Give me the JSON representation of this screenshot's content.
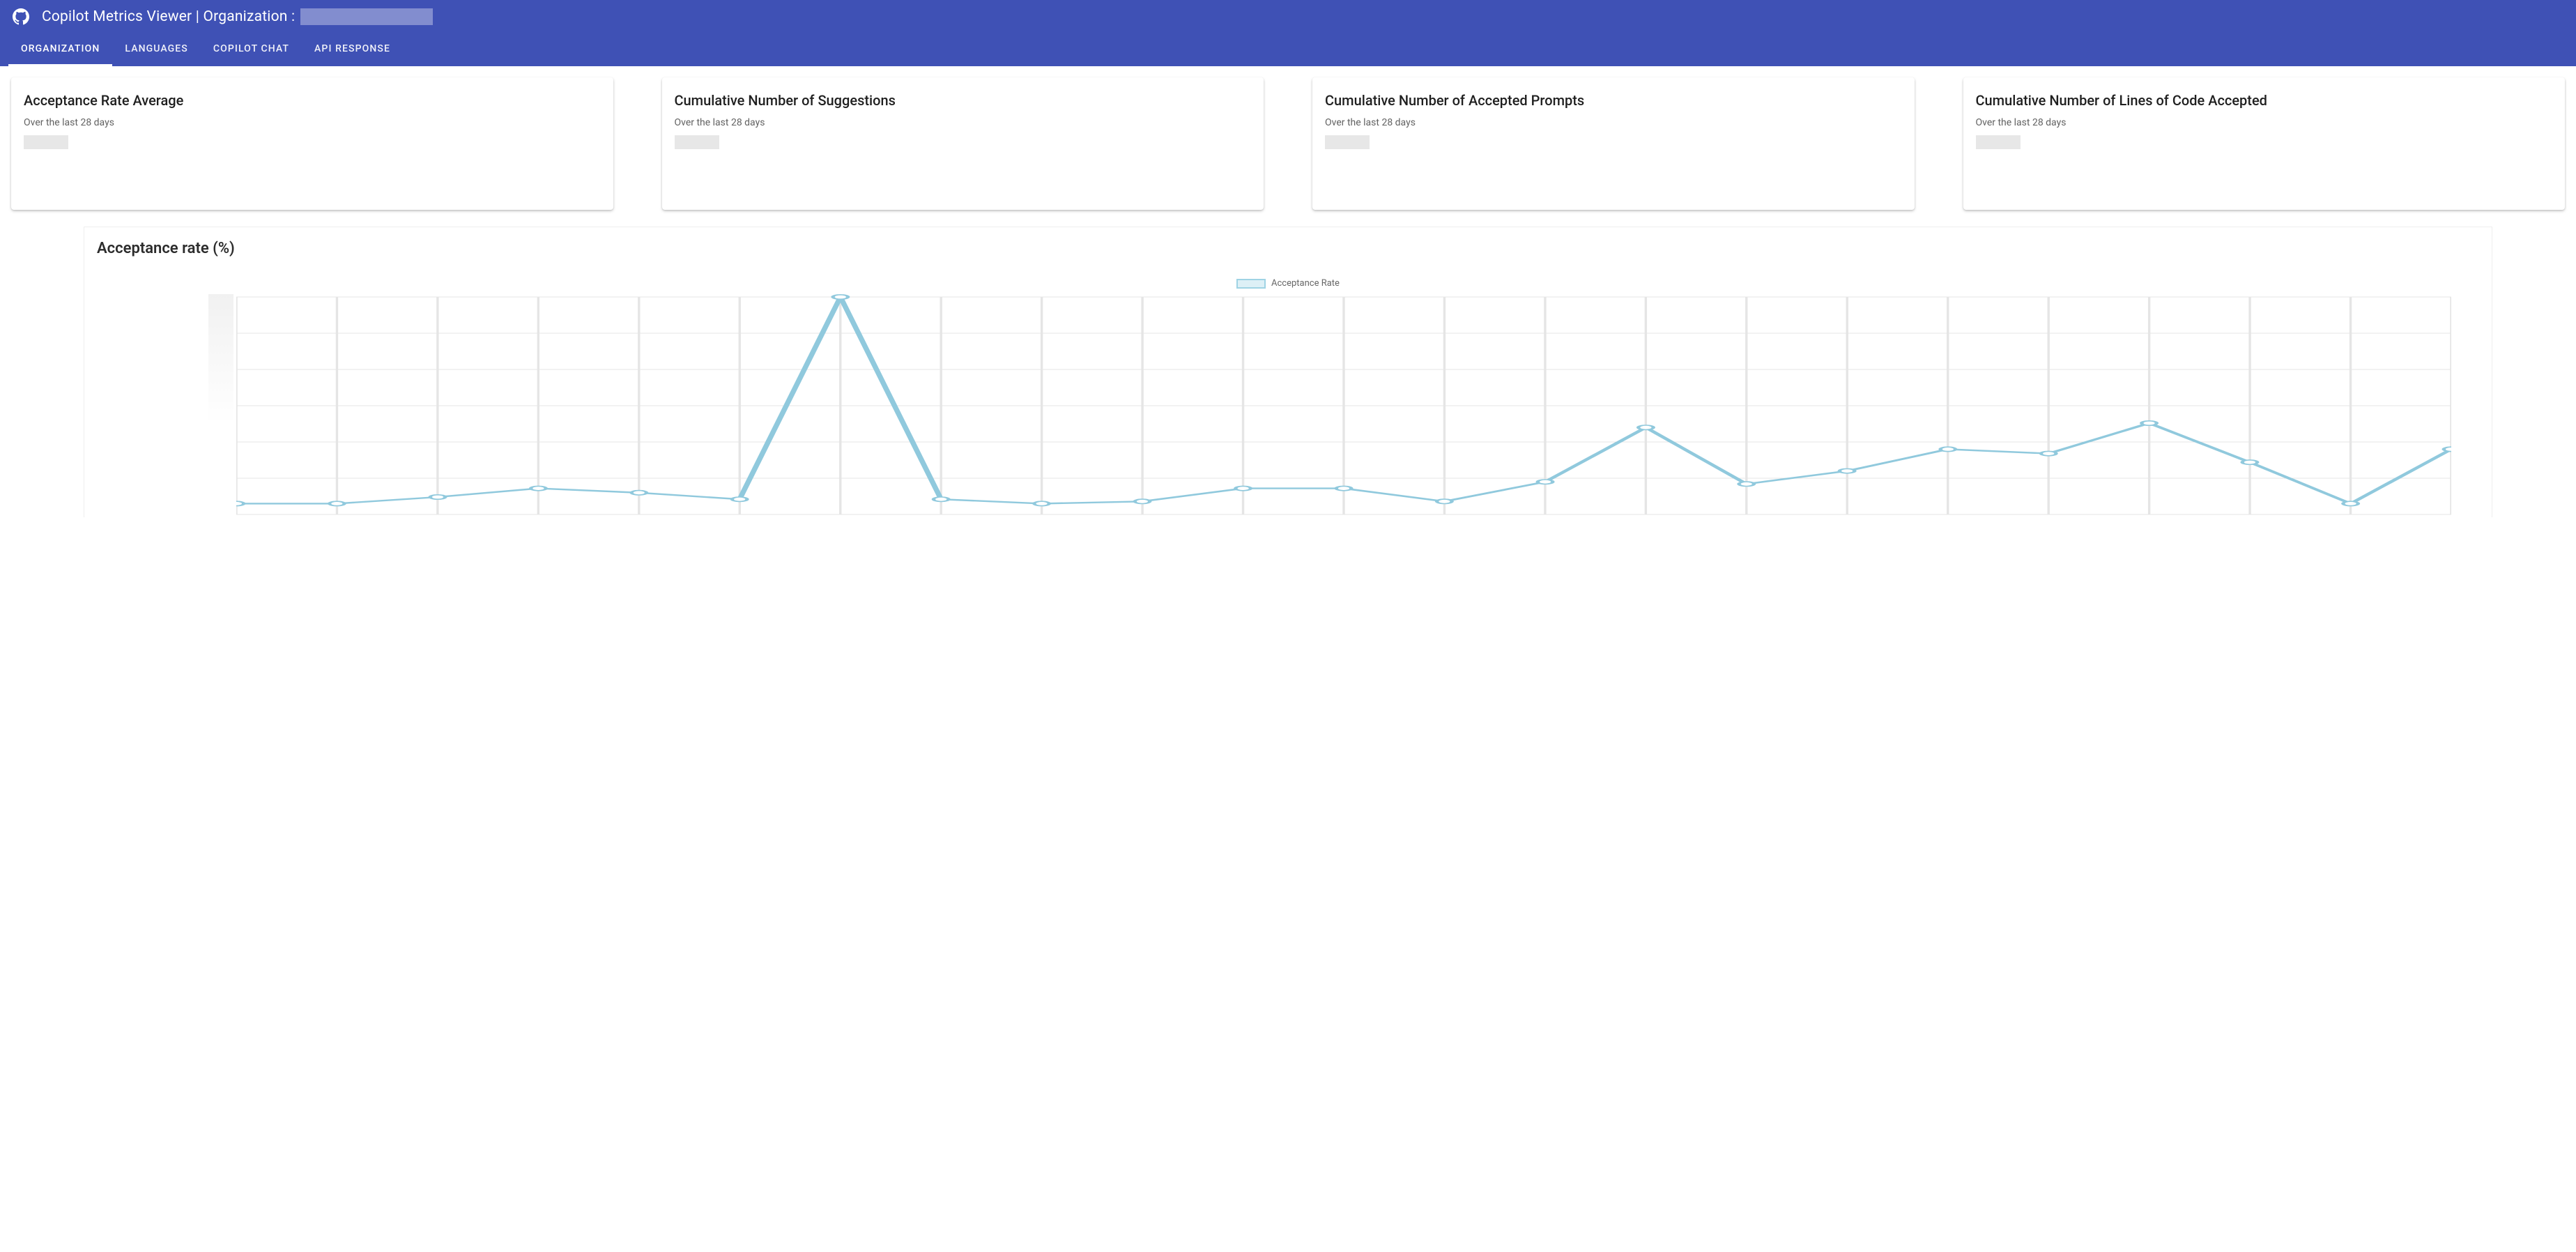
{
  "header": {
    "title_prefix": "Copilot Metrics Viewer | Organization :",
    "org_name_redacted": true
  },
  "tabs": [
    {
      "label": "ORGANIZATION",
      "active": true
    },
    {
      "label": "LANGUAGES",
      "active": false
    },
    {
      "label": "COPILOT CHAT",
      "active": false
    },
    {
      "label": "API RESPONSE",
      "active": false
    }
  ],
  "cards": [
    {
      "title": "Acceptance Rate Average",
      "subtitle": "Over the last 28 days",
      "value_redacted": true
    },
    {
      "title": "Cumulative Number of Suggestions",
      "subtitle": "Over the last 28 days",
      "value_redacted": true
    },
    {
      "title": "Cumulative Number of Accepted Prompts",
      "subtitle": "Over the last 28 days",
      "value_redacted": true
    },
    {
      "title": "Cumulative Number of Lines of Code Accepted",
      "subtitle": "Over the last 28 days",
      "value_redacted": true
    }
  ],
  "chart": {
    "title": "Acceptance rate (%)",
    "legend_label": "Acceptance Rate"
  },
  "chart_data": {
    "type": "line",
    "title": "Acceptance rate (%)",
    "series_name": "Acceptance Rate",
    "ylabel": "",
    "xlabel": "",
    "y_axis_redacted": true,
    "x_ticks_hidden": true,
    "grid": true,
    "n_points": 23,
    "ylim_relative": [
      0,
      100
    ],
    "values_relative": [
      5,
      5,
      8,
      12,
      10,
      7,
      100,
      7,
      5,
      6,
      12,
      12,
      6,
      15,
      40,
      14,
      20,
      30,
      28,
      42,
      24,
      5,
      30
    ],
    "note": "Y-axis tick labels are redacted in the screenshot; values are relative heights read from the plot on a 0–100 scale, not absolute percentages."
  },
  "colors": {
    "primary": "#3f51b5",
    "line": "#90c9dd",
    "grid": "#e5e5e5"
  }
}
